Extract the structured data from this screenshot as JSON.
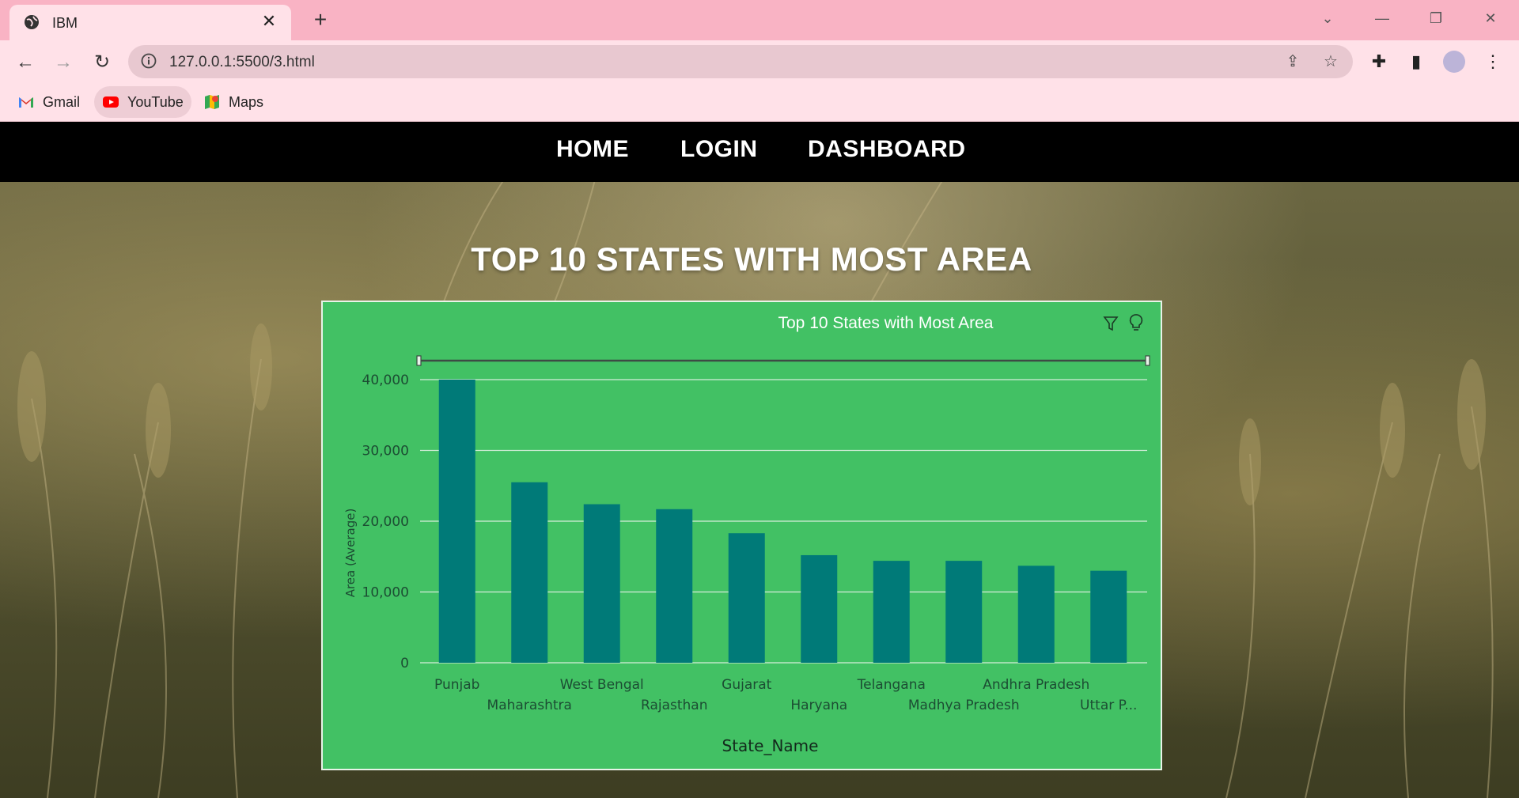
{
  "browser": {
    "tab_title": "IBM",
    "url": "127.0.0.1:5500/3.html",
    "bookmarks": [
      {
        "label": "Gmail",
        "icon": "gmail-icon"
      },
      {
        "label": "YouTube",
        "icon": "youtube-icon"
      },
      {
        "label": "Maps",
        "icon": "maps-icon"
      }
    ]
  },
  "nav": {
    "home": "HOME",
    "login": "LOGIN",
    "dashboard": "DASHBOARD"
  },
  "page": {
    "heading": "TOP 10 STATES WITH MOST AREA"
  },
  "colors": {
    "panel": "#42c164",
    "bar": "#007a78",
    "nav_bg": "#000000",
    "tab_strip": "#f9b3c4"
  },
  "chart_data": {
    "type": "bar",
    "title": "Top 10 States with Most Area",
    "xlabel": "State_Name",
    "ylabel": "Area (Average)",
    "ylim": [
      0,
      40000
    ],
    "yticks": [
      "0",
      "10,000",
      "20,000",
      "30,000",
      "40,000"
    ],
    "grid": true,
    "categories": [
      "Punjab",
      "Maharashtra",
      "West Bengal",
      "Rajasthan",
      "Gujarat",
      "Haryana",
      "Telangana",
      "Madhya Pradesh",
      "Andhra Pradesh",
      "Uttar P..."
    ],
    "values": [
      40000,
      25500,
      22400,
      21700,
      18300,
      15200,
      14400,
      14400,
      13700,
      13000
    ]
  }
}
